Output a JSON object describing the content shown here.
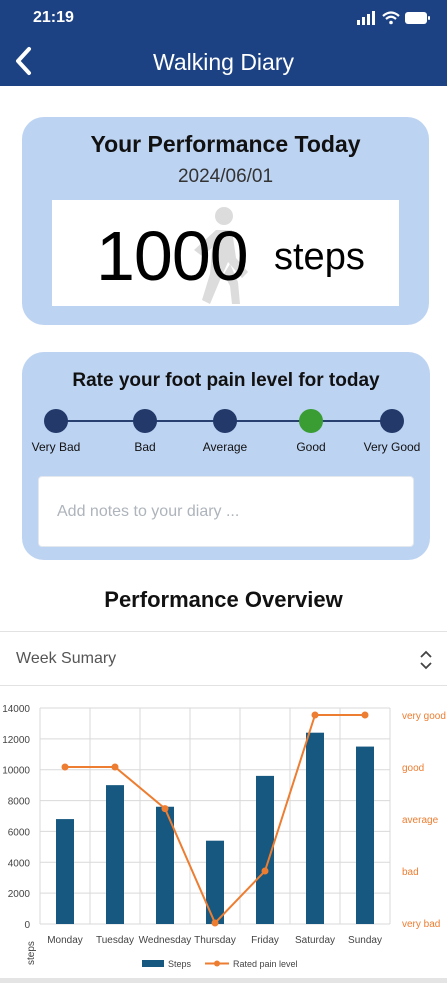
{
  "status": {
    "time": "21:19"
  },
  "header": {
    "title": "Walking Diary"
  },
  "performance": {
    "title": "Your Performance Today",
    "date": "2024/06/01",
    "steps": "1000",
    "unit": "steps"
  },
  "pain": {
    "title": "Rate your foot pain level for today",
    "levels": [
      "Very Bad",
      "Bad",
      "Average",
      "Good",
      "Very Good"
    ],
    "selected_index": 3,
    "notes_placeholder": "Add notes to your diary ..."
  },
  "overview": {
    "title": "Performance Overview",
    "period_select": "Week Sumary"
  },
  "colors": {
    "header": "#1d4283",
    "card": "#bdd3f2",
    "selected_dot": "#3a9d34",
    "bar": "#175880",
    "line": "#ed7d31"
  },
  "chart_data": {
    "type": "bar",
    "categories": [
      "Monday",
      "Tuesday",
      "Wednesday",
      "Thursday",
      "Friday",
      "Saturday",
      "Sunday"
    ],
    "series": [
      {
        "name": "Steps",
        "type": "bar",
        "values": [
          6800,
          9000,
          7600,
          5400,
          9600,
          12400,
          11500
        ]
      },
      {
        "name": "Rated pain level",
        "type": "line",
        "axis": "right",
        "values": [
          3,
          3,
          2.2,
          0,
          1,
          4,
          4
        ]
      }
    ],
    "ylabel": "steps",
    "ylim": [
      0,
      14000
    ],
    "yticks": [
      "0",
      "2000",
      "4000",
      "6000",
      "8000",
      "10000",
      "12000",
      "14000"
    ],
    "right_axis_labels": [
      "very bad",
      "bad",
      "average",
      "good",
      "very good"
    ],
    "right_ylim": [
      0,
      4
    ],
    "grid": true,
    "legend": "bottom"
  }
}
